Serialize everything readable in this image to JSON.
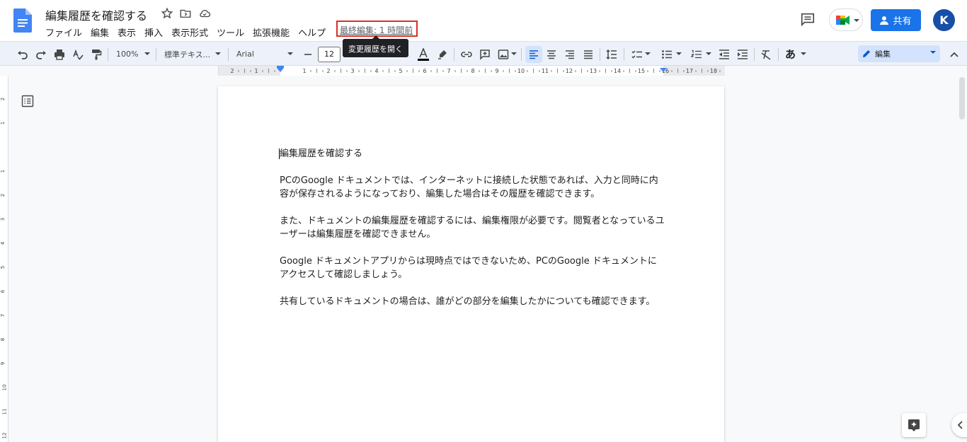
{
  "document": {
    "title": "編集履歴を確認する",
    "last_edit": "最終編集: 1 時間前",
    "tooltip": "変更履歴を開く"
  },
  "menu": [
    {
      "label": "ファイル"
    },
    {
      "label": "編集"
    },
    {
      "label": "表示"
    },
    {
      "label": "挿入"
    },
    {
      "label": "表示形式"
    },
    {
      "label": "ツール"
    },
    {
      "label": "拡張機能"
    },
    {
      "label": "ヘルプ"
    }
  ],
  "header": {
    "share_label": "共有",
    "avatar_initial": "K"
  },
  "toolbar": {
    "zoom": "100%",
    "style": "標準テキス...",
    "font": "Arial",
    "font_size": "12",
    "mode": "編集",
    "input_char": "あ"
  },
  "ruler": {
    "marks": [
      "2",
      "1",
      "1",
      "2",
      "3",
      "4",
      "5",
      "6",
      "7",
      "8",
      "9",
      "10",
      "11",
      "12",
      "13",
      "14",
      "15",
      "16",
      "17",
      "18"
    ],
    "vmarks": [
      "2",
      "1",
      "1",
      "2",
      "3",
      "4",
      "5",
      "6",
      "7",
      "8",
      "9",
      "10",
      "11",
      "12"
    ]
  },
  "body": {
    "paragraphs": [
      "編集履歴を確認する",
      "PCのGoogle ドキュメントでは、インターネットに接続した状態であれば、入力と同時に内容が保存されるようになっており、編集した場合はその履歴を確認できます。",
      "また、ドキュメントの編集履歴を確認するには、編集権限が必要です。閲覧者となっているユーザーは編集履歴を確認できません。",
      "Google ドキュメントアプリからは現時点ではできないため、PCのGoogle ドキュメントにアクセスして確認しましょう。",
      "共有しているドキュメントの場合は、誰がどの部分を編集したかについても確認できます。"
    ]
  },
  "colors": {
    "accent": "#1a73e8",
    "highlight_box": "#d93025",
    "toolbar_bg": "#edf2fa"
  },
  "icons": [
    "docs-logo-icon",
    "star-icon",
    "move-folder-icon",
    "cloud-status-icon",
    "comment-history-icon",
    "meet-icon",
    "person-icon",
    "undo-icon",
    "redo-icon",
    "print-icon",
    "spellcheck-icon",
    "paint-format-icon",
    "text-color-icon",
    "highlight-icon",
    "link-icon",
    "add-comment-icon",
    "image-icon",
    "align-left-icon",
    "align-center-icon",
    "align-right-icon",
    "justify-icon",
    "line-spacing-icon",
    "checklist-icon",
    "bullet-list-icon",
    "numbered-list-icon",
    "decrease-indent-icon",
    "increase-indent-icon",
    "clear-format-icon",
    "pencil-icon",
    "chevron-up-icon",
    "outline-icon",
    "explore-icon",
    "chevron-left-icon"
  ]
}
